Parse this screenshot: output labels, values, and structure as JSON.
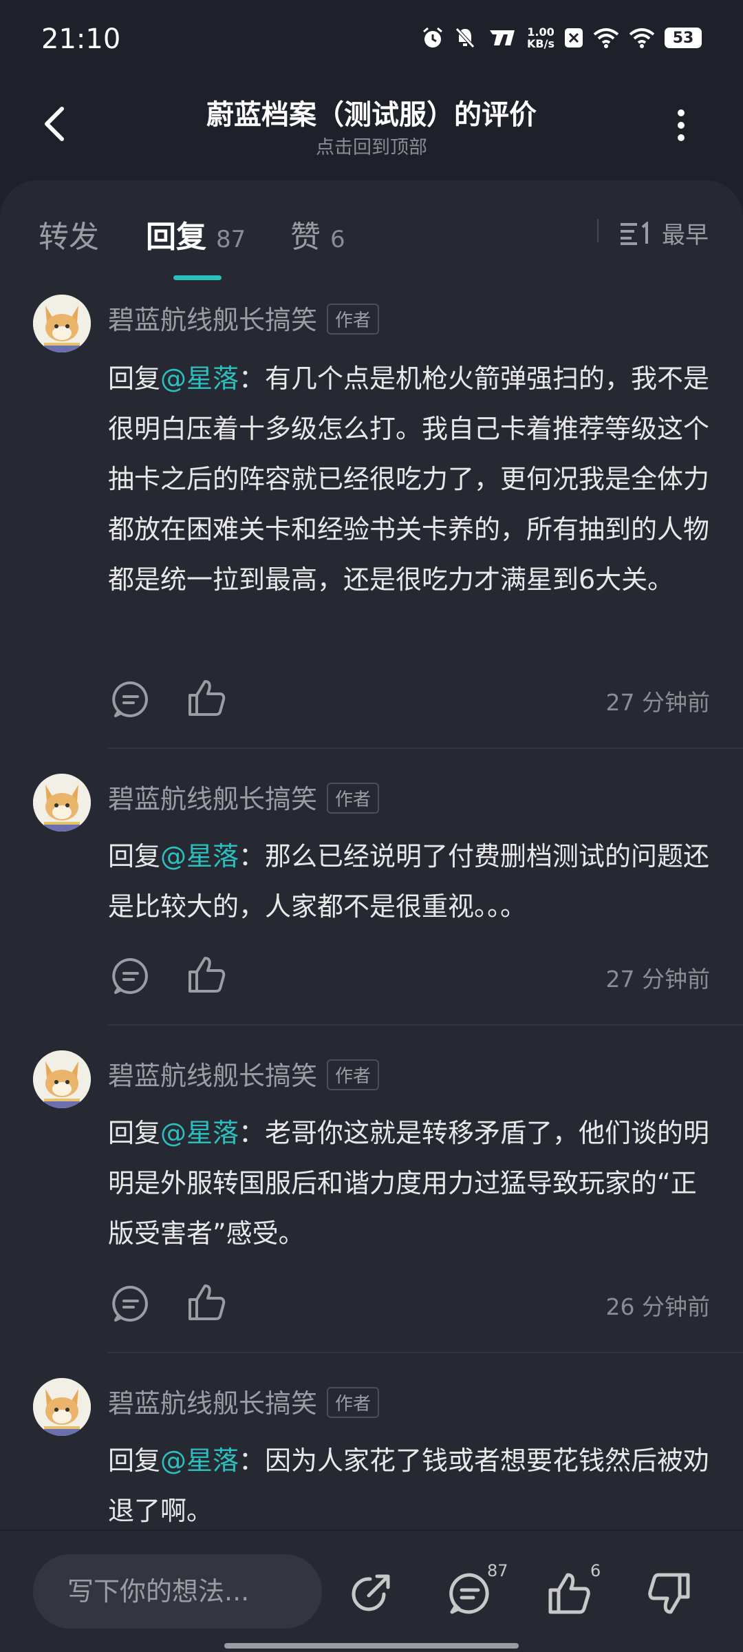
{
  "status_bar": {
    "time": "21:10",
    "net_speed_value": "1.00",
    "net_speed_unit": "KB/s",
    "battery": "53",
    "icons": [
      "alarm-icon",
      "mute-icon",
      "carrier-icon",
      "close-box-icon",
      "wifi-icon",
      "wifi-icon",
      "battery-icon"
    ]
  },
  "header": {
    "title": "蔚蓝档案（测试服）的评价",
    "subtitle": "点击回到顶部"
  },
  "tabs": [
    {
      "label": "转发",
      "count": ""
    },
    {
      "label": "回复",
      "count": "87"
    },
    {
      "label": "赞",
      "count": "6"
    }
  ],
  "active_tab": "回复",
  "sort": {
    "label": "最早"
  },
  "comments": [
    {
      "user": "碧蓝航线舰长搞笑",
      "tag": "作者",
      "prefix": "回复",
      "mention": "@星落",
      "text": "：有几个点是机枪火箭弹强扫的，我不是很明白压着十多级怎么打。我自己卡着推荐等级这个抽卡之后的阵容就已经很吃力了，更何况我是全体力都放在困难关卡和经验书关卡养的，所有抽到的人物都是统一拉到最高，还是很吃力才满星到6大关。",
      "time": "27 分钟前"
    },
    {
      "user": "碧蓝航线舰长搞笑",
      "tag": "作者",
      "prefix": "回复",
      "mention": "@星落",
      "text": "：那么已经说明了付费删档测试的问题还是比较大的，人家都不是很重视。。。",
      "time": "27 分钟前"
    },
    {
      "user": "碧蓝航线舰长搞笑",
      "tag": "作者",
      "prefix": "回复",
      "mention": "@星落",
      "text": "：老哥你这就是转移矛盾了，他们谈的明明是外服转国服后和谐力度用力过猛导致玩家的“正版受害者”感受。",
      "time": "26 分钟前"
    },
    {
      "user": "碧蓝航线舰长搞笑",
      "tag": "作者",
      "prefix": "回复",
      "mention": "@星落",
      "text": "：因为人家花了钱或者想要花钱然后被劝退了啊。",
      "time": ""
    }
  ],
  "bottom_bar": {
    "input_placeholder": "写下你的想法...",
    "reply_count": "87",
    "like_count": "6"
  },
  "colors": {
    "accent": "#2bbfbf",
    "background": "#1e2129",
    "panel": "#262932"
  }
}
